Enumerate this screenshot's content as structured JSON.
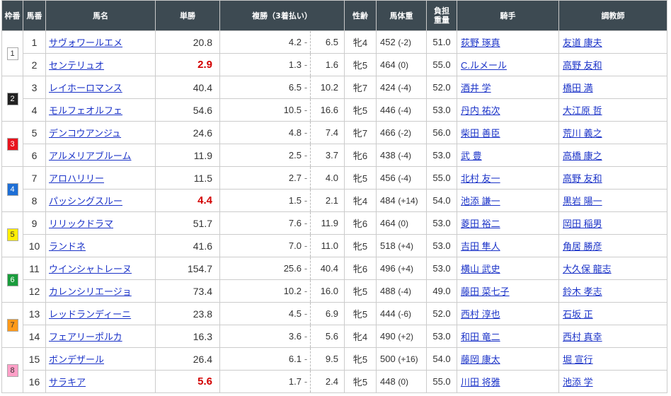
{
  "headers": {
    "waku": "枠番",
    "umaban": "馬番",
    "name": "馬名",
    "tansho": "単勝",
    "fukusho": "複勝（3着払い）",
    "sexage": "性齢",
    "weight": "馬体重",
    "kinryo": "負担重量",
    "jockey": "騎手",
    "trainer": "調教師"
  },
  "waku_colors": {
    "1": {
      "bg": "#ffffff",
      "fg": "#333333"
    },
    "2": {
      "bg": "#222222",
      "fg": "#ffffff"
    },
    "3": {
      "bg": "#e8141e",
      "fg": "#ffffff"
    },
    "4": {
      "bg": "#1e6fd6",
      "fg": "#ffffff"
    },
    "5": {
      "bg": "#ffee00",
      "fg": "#333333"
    },
    "6": {
      "bg": "#1a9c3c",
      "fg": "#ffffff"
    },
    "7": {
      "bg": "#ff9a1a",
      "fg": "#333333"
    },
    "8": {
      "bg": "#ff9fc7",
      "fg": "#333333"
    }
  },
  "rows": [
    {
      "waku": "1",
      "num": "1",
      "name": "サヴォワールエメ",
      "tan": "20.8",
      "fav": false,
      "fmin": "4.2",
      "fmax": "6.5",
      "sex": "牝4",
      "wt": "452",
      "diff": "(-2)",
      "kin": "51.0",
      "jockey": "荻野 琢真",
      "trainer": "友道 康夫"
    },
    {
      "waku": "",
      "num": "2",
      "name": "センテリュオ",
      "tan": "2.9",
      "fav": true,
      "fmin": "1.3",
      "fmax": "1.6",
      "sex": "牝5",
      "wt": "464",
      "diff": "(0)",
      "kin": "55.0",
      "jockey": "C.ルメール",
      "trainer": "高野 友和"
    },
    {
      "waku": "2",
      "num": "3",
      "name": "レイホーロマンス",
      "tan": "40.4",
      "fav": false,
      "fmin": "6.5",
      "fmax": "10.2",
      "sex": "牝7",
      "wt": "424",
      "diff": "(-4)",
      "kin": "52.0",
      "jockey": "酒井 学",
      "trainer": "橋田 満"
    },
    {
      "waku": "",
      "num": "4",
      "name": "モルフェオルフェ",
      "tan": "54.6",
      "fav": false,
      "fmin": "10.5",
      "fmax": "16.6",
      "sex": "牝5",
      "wt": "446",
      "diff": "(-4)",
      "kin": "53.0",
      "jockey": "丹内 祐次",
      "trainer": "大江原 哲"
    },
    {
      "waku": "3",
      "num": "5",
      "name": "デンコウアンジュ",
      "tan": "24.6",
      "fav": false,
      "fmin": "4.8",
      "fmax": "7.4",
      "sex": "牝7",
      "wt": "466",
      "diff": "(-2)",
      "kin": "56.0",
      "jockey": "柴田 善臣",
      "trainer": "荒川 義之"
    },
    {
      "waku": "",
      "num": "6",
      "name": "アルメリアブルーム",
      "tan": "11.9",
      "fav": false,
      "fmin": "2.5",
      "fmax": "3.7",
      "sex": "牝6",
      "wt": "438",
      "diff": "(-4)",
      "kin": "53.0",
      "jockey": "武 豊",
      "trainer": "高橋 康之"
    },
    {
      "waku": "4",
      "num": "7",
      "name": "アロハリリー",
      "tan": "11.5",
      "fav": false,
      "fmin": "2.7",
      "fmax": "4.0",
      "sex": "牝5",
      "wt": "456",
      "diff": "(-4)",
      "kin": "55.0",
      "jockey": "北村 友一",
      "trainer": "高野 友和"
    },
    {
      "waku": "",
      "num": "8",
      "name": "パッシングスルー",
      "tan": "4.4",
      "fav": true,
      "fmin": "1.5",
      "fmax": "2.1",
      "sex": "牝4",
      "wt": "484",
      "diff": "(+14)",
      "kin": "54.0",
      "jockey": "池添 謙一",
      "trainer": "黒岩 陽一"
    },
    {
      "waku": "5",
      "num": "9",
      "name": "リリックドラマ",
      "tan": "51.7",
      "fav": false,
      "fmin": "7.6",
      "fmax": "11.9",
      "sex": "牝6",
      "wt": "464",
      "diff": "(0)",
      "kin": "53.0",
      "jockey": "菱田 裕二",
      "trainer": "岡田 稲男"
    },
    {
      "waku": "",
      "num": "10",
      "name": "ランドネ",
      "tan": "41.6",
      "fav": false,
      "fmin": "7.0",
      "fmax": "11.0",
      "sex": "牝5",
      "wt": "518",
      "diff": "(+4)",
      "kin": "53.0",
      "jockey": "吉田 隼人",
      "trainer": "角居 勝彦"
    },
    {
      "waku": "6",
      "num": "11",
      "name": "ウインシャトレーヌ",
      "tan": "154.7",
      "fav": false,
      "fmin": "25.6",
      "fmax": "40.4",
      "sex": "牝6",
      "wt": "496",
      "diff": "(+4)",
      "kin": "53.0",
      "jockey": "横山 武史",
      "trainer": "大久保 龍志"
    },
    {
      "waku": "",
      "num": "12",
      "name": "カレンシリエージョ",
      "tan": "73.4",
      "fav": false,
      "fmin": "10.2",
      "fmax": "16.0",
      "sex": "牝5",
      "wt": "488",
      "diff": "(-4)",
      "kin": "49.0",
      "jockey": "藤田 菜七子",
      "trainer": "鈴木 孝志"
    },
    {
      "waku": "7",
      "num": "13",
      "name": "レッドランディーニ",
      "tan": "23.8",
      "fav": false,
      "fmin": "4.5",
      "fmax": "6.9",
      "sex": "牝5",
      "wt": "444",
      "diff": "(-6)",
      "kin": "52.0",
      "jockey": "西村 淳也",
      "trainer": "石坂 正"
    },
    {
      "waku": "",
      "num": "14",
      "name": "フェアリーポルカ",
      "tan": "16.3",
      "fav": false,
      "fmin": "3.6",
      "fmax": "5.6",
      "sex": "牝4",
      "wt": "490",
      "diff": "(+2)",
      "kin": "53.0",
      "jockey": "和田 竜二",
      "trainer": "西村 真幸"
    },
    {
      "waku": "8",
      "num": "15",
      "name": "ボンデザール",
      "tan": "26.4",
      "fav": false,
      "fmin": "6.1",
      "fmax": "9.5",
      "sex": "牝5",
      "wt": "500",
      "diff": "(+16)",
      "kin": "54.0",
      "jockey": "藤岡 康太",
      "trainer": "堀 宣行"
    },
    {
      "waku": "",
      "num": "16",
      "name": "サラキア",
      "tan": "5.6",
      "fav": true,
      "fmin": "1.7",
      "fmax": "2.4",
      "sex": "牝5",
      "wt": "448",
      "diff": "(0)",
      "kin": "55.0",
      "jockey": "川田 将雅",
      "trainer": "池添 学"
    }
  ]
}
